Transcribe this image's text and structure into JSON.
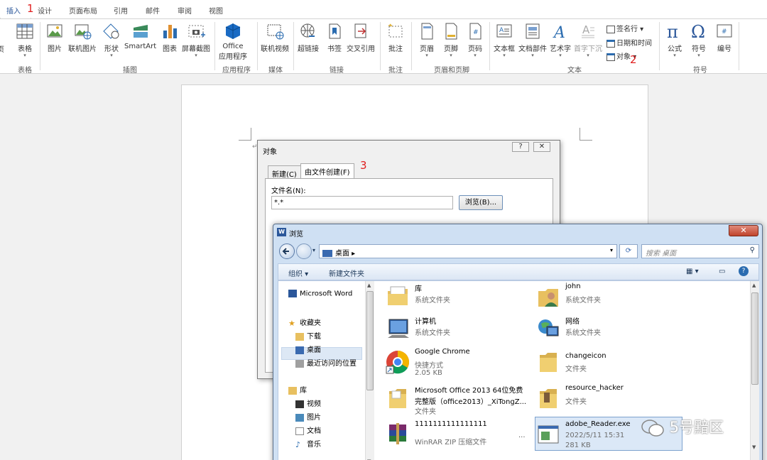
{
  "tabs": [
    {
      "label": "插入"
    },
    {
      "label": "设计"
    },
    {
      "label": "页面布局"
    },
    {
      "label": "引用"
    },
    {
      "label": "邮件"
    },
    {
      "label": "审阅"
    },
    {
      "label": "视图"
    }
  ],
  "annotations": {
    "one": "1",
    "two": "2",
    "three": "3"
  },
  "ribbon": {
    "buttons": {
      "table": "表格",
      "picture": "图片",
      "online_picture": "联机图片",
      "shapes": "形状",
      "smartart": "SmartArt",
      "chart": "图表",
      "screenshot": "屏幕截图",
      "office_apps_1": "Office",
      "office_apps_2": "应用程序",
      "online_video": "联机视频",
      "hyperlink": "超链接",
      "bookmark": "书签",
      "cross_ref": "交叉引用",
      "comment": "批注",
      "header": "页眉",
      "footer": "页脚",
      "page_number": "页码",
      "textbox": "文本框",
      "quick_parts": "文档部件",
      "wordart": "艺术字",
      "dropcap": "首字下沉",
      "signature_line": "签名行",
      "date_time": "日期和时间",
      "object": "对象",
      "equation": "公式",
      "symbol": "符号",
      "numbering": "编号"
    },
    "groups": {
      "tables": "表格",
      "illustrations": "插图",
      "apps": "应用程序",
      "media": "媒体",
      "links": "链接",
      "comments": "批注",
      "header_footer": "页眉和页脚",
      "text": "文本",
      "symbols": "符号"
    },
    "partial_left": "页"
  },
  "object_dialog": {
    "title": "对象",
    "help": "?",
    "close": "✕",
    "tab_new": "新建(C)",
    "tab_from_file": "由文件创建(F)",
    "filename_label": "文件名(N):",
    "filename_value": "*.*",
    "browse_button": "浏览(B)..."
  },
  "browse_dialog": {
    "title": "浏览",
    "close": "✕",
    "address": "桌面",
    "search_placeholder": "搜索 桌面",
    "toolbar": {
      "organize": "组织 ▾",
      "new_folder": "新建文件夹"
    },
    "nav": [
      {
        "label": "Microsoft Word"
      },
      {
        "label": "收藏夹"
      },
      {
        "label": "下载"
      },
      {
        "label": "桌面"
      },
      {
        "label": "最近访问的位置"
      },
      {
        "label": "库"
      },
      {
        "label": "视频"
      },
      {
        "label": "图片"
      },
      {
        "label": "文档"
      },
      {
        "label": "音乐"
      }
    ],
    "files": [
      {
        "name": "库",
        "type": "系统文件夹",
        "size": "",
        "icon": "library-icon"
      },
      {
        "name": "john",
        "type": "系统文件夹",
        "size": "",
        "icon": "user-folder-icon"
      },
      {
        "name": "计算机",
        "type": "系统文件夹",
        "size": "",
        "icon": "computer-icon"
      },
      {
        "name": "网络",
        "type": "系统文件夹",
        "size": "",
        "icon": "network-icon"
      },
      {
        "name": "Google Chrome",
        "type": "快捷方式",
        "size": "2.05 KB",
        "icon": "chrome-icon"
      },
      {
        "name": "changeicon",
        "type": "文件夹",
        "size": "",
        "icon": "folder-icon"
      },
      {
        "name": "Microsoft Office 2013 64位免费",
        "type": "完整版（office2013）_XiTongZ...",
        "size": "文件夹",
        "icon": "folder-icon"
      },
      {
        "name": "resource_hacker",
        "type": "文件夹",
        "size": "",
        "icon": "folder-icon"
      },
      {
        "name": "1111111111111111",
        "type": "WinRAR ZIP 压缩文件",
        "size": "",
        "icon": "winrar-icon"
      },
      {
        "name": "adobe_Reader.exe",
        "type": "2022/5/11 15:31",
        "size": "281 KB",
        "icon": "exe-icon"
      }
    ],
    "ellipsis": "..."
  },
  "watermark": "5号黯区",
  "colors": {
    "accent": "#2b579a",
    "annotation": "#e02020",
    "selection": "#dbe8f7"
  }
}
